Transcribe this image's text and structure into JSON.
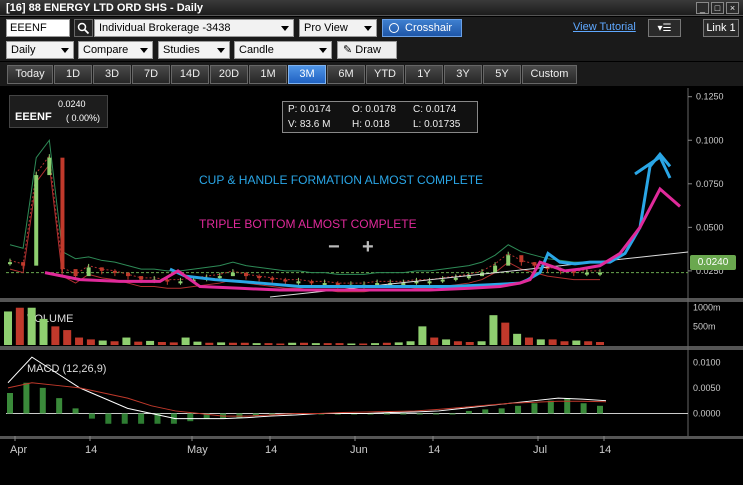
{
  "window": {
    "title": "[16] 88 ENERGY LTD ORD SHS - Daily",
    "buttons": [
      "_",
      "□",
      "×"
    ]
  },
  "toolbar": {
    "symbol": "EEENF",
    "account": "Individual Brokerage -3438",
    "view": "Pro View",
    "crosshair": "Crosshair",
    "tutorial": "View Tutorial",
    "link": "Link 1",
    "interval": "Daily",
    "compare": "Compare",
    "studies": "Studies",
    "chart_type": "Candle",
    "draw": "Draw"
  },
  "periods": [
    "Today",
    "1D",
    "3D",
    "7D",
    "14D",
    "20D",
    "1M",
    "3M",
    "6M",
    "YTD",
    "1Y",
    "3Y",
    "5Y",
    "Custom"
  ],
  "active_period": "3M",
  "quote": {
    "symbol": "EEENF",
    "price": "0.0240",
    "change": "( 0.00%)"
  },
  "ohlc": {
    "p": "P: 0.0174",
    "o": "O: 0.0178",
    "c": "C: 0.0174",
    "v": "V: 83.6 M",
    "h": "H: 0.018",
    "l": "L: 0.01735"
  },
  "last_price_tag": "0.0240",
  "annotations": {
    "cup": "CUP & HANDLE FORMATION ALMOST COMPLETE",
    "triple": "TRIPLE BOTTOM ALMOST COMPLETE",
    "minus": "−",
    "plus": "+"
  },
  "panels": {
    "volume": "VOLUME",
    "macd": "MACD (12,26,9)"
  },
  "colors": {
    "accent": "#2062c2",
    "cup": "#2aa6e6",
    "triple": "#e02a9a",
    "up": "#8fcf70",
    "down": "#c0392b",
    "pricetag": "#6aa84f"
  },
  "chart_data": [
    {
      "type": "line",
      "title": "",
      "y_ticks": [
        "0.1250",
        "0.1000",
        "0.0750",
        "0.0500",
        "0.0250"
      ],
      "x_ticks": [
        "Apr",
        "14",
        "May",
        "14",
        "Jun",
        "14",
        "Jul",
        "14"
      ],
      "ylim": [
        0.01,
        0.13
      ],
      "price_close": [
        0.03,
        0.028,
        0.08,
        0.09,
        0.026,
        0.022,
        0.027,
        0.025,
        0.024,
        0.022,
        0.02,
        0.02,
        0.019,
        0.019,
        0.02,
        0.021,
        0.022,
        0.024,
        0.022,
        0.021,
        0.02,
        0.019,
        0.019,
        0.018,
        0.018,
        0.017,
        0.017,
        0.017,
        0.018,
        0.018,
        0.018,
        0.019,
        0.019,
        0.02,
        0.021,
        0.022,
        0.024,
        0.028,
        0.034,
        0.03,
        0.028,
        0.026,
        0.025,
        0.024,
        0.024,
        0.024
      ],
      "cup_annotation_line": [
        0.026,
        0.022,
        0.02,
        0.018,
        0.016,
        0.016,
        0.016,
        0.016,
        0.017,
        0.018,
        0.02,
        0.022,
        0.024,
        0.035,
        0.03,
        0.029,
        0.03,
        0.03,
        0.035,
        0.05,
        0.085,
        0.092,
        0.085
      ],
      "triple_annotation_line": [
        0.024,
        0.02,
        0.019,
        0.019,
        0.025,
        0.016,
        0.015,
        0.014,
        0.014,
        0.014,
        0.014,
        0.015,
        0.016,
        0.018,
        0.02,
        0.03,
        0.028,
        0.025,
        0.026,
        0.028,
        0.035,
        0.05,
        0.072,
        0.062
      ]
    },
    {
      "type": "bar",
      "title": "VOLUME",
      "y_ticks": [
        "1000m",
        "500m"
      ],
      "ylim": [
        0,
        1100
      ],
      "values": [
        900,
        1000,
        1000,
        700,
        500,
        400,
        200,
        150,
        120,
        100,
        200,
        90,
        110,
        80,
        70,
        200,
        90,
        60,
        70,
        60,
        60,
        50,
        50,
        40,
        60,
        60,
        50,
        50,
        50,
        40,
        40,
        50,
        60,
        70,
        100,
        500,
        200,
        150,
        100,
        80,
        100,
        800,
        600,
        300,
        200,
        150,
        150,
        100,
        120,
        100,
        80
      ],
      "up": [
        true,
        false,
        true,
        true,
        false,
        false,
        false,
        false,
        true,
        false,
        true,
        false,
        true,
        false,
        false,
        true,
        true,
        false,
        true,
        false,
        false,
        true,
        false,
        false,
        true,
        false,
        true,
        false,
        false,
        true,
        false,
        true,
        false,
        true,
        true,
        true,
        false,
        true,
        false,
        false,
        true,
        true,
        false,
        true,
        false,
        true,
        false,
        false,
        true,
        false,
        false
      ]
    },
    {
      "type": "bar",
      "title": "MACD (12,26,9)",
      "y_ticks": [
        "0.0100",
        "0.0050",
        "0.0000"
      ],
      "ylim": [
        -0.004,
        0.012
      ],
      "histogram": [
        0.004,
        0.006,
        0.005,
        0.003,
        0.001,
        -0.001,
        -0.002,
        -0.002,
        -0.002,
        -0.002,
        -0.002,
        -0.0015,
        -0.001,
        -0.001,
        -0.0008,
        -0.0005,
        -0.0003,
        -0.0002,
        0.0,
        0.0,
        0.0,
        0.0,
        0.0,
        0.0,
        0.0,
        0.0,
        0.0,
        0.0,
        0.0005,
        0.0008,
        0.001,
        0.0015,
        0.002,
        0.0025,
        0.003,
        0.002,
        0.0015
      ],
      "macd_line": [
        0.006,
        0.011,
        0.008,
        0.005,
        0.003,
        0.001,
        0.0,
        -0.001,
        -0.001,
        -0.001,
        -0.0008,
        -0.0005,
        -0.0003,
        0.0,
        0.0,
        0.0,
        0.0002,
        0.0003,
        0.0005,
        0.001,
        0.0015,
        0.002,
        0.0025,
        0.003,
        0.0028,
        0.0025
      ],
      "signal_line": [
        0.005,
        0.006,
        0.0055,
        0.005,
        0.004,
        0.003,
        0.0015,
        0.0005,
        0.0,
        -0.0005,
        -0.0005,
        -0.0003,
        0.0,
        0.0,
        0.0002,
        0.0003,
        0.0004,
        0.0005,
        0.0008,
        0.0012,
        0.0016,
        0.002,
        0.0022,
        0.0024,
        0.0024,
        0.0023
      ]
    }
  ]
}
